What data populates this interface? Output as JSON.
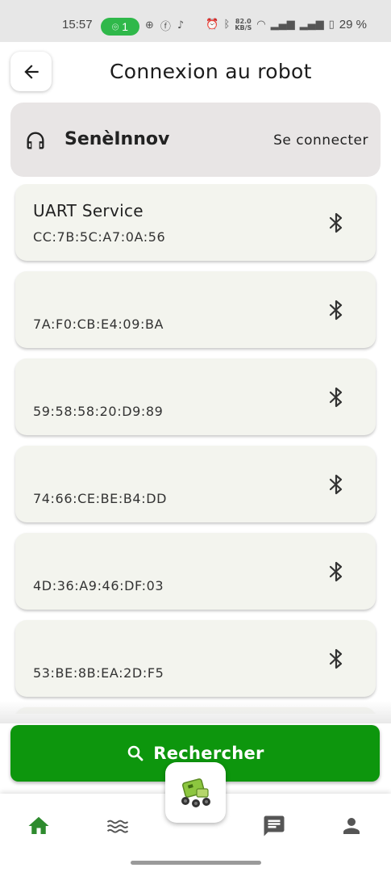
{
  "status_bar": {
    "time": "15:57",
    "hotspot_count": "1",
    "network_speed_top": "82.0",
    "network_speed_unit": "KB/S",
    "battery": "29 %"
  },
  "header": {
    "title": "Connexion au robot",
    "back_icon": "arrow-left-icon"
  },
  "connected_device": {
    "icon": "headphones-icon",
    "name": "SenèInnov",
    "action_label": "Se connecter"
  },
  "devices": [
    {
      "name": "UART Service",
      "mac": "CC:7B:5C:A7:0A:56"
    },
    {
      "name": "",
      "mac": "7A:F0:CB:E4:09:BA"
    },
    {
      "name": "",
      "mac": "59:58:58:20:D9:89"
    },
    {
      "name": "",
      "mac": "74:66:CE:BE:B4:DD"
    },
    {
      "name": "",
      "mac": "4D:36:A9:46:DF:03"
    },
    {
      "name": "",
      "mac": "53:BE:8B:EA:2D:F5"
    }
  ],
  "search_button": {
    "label": "Rechercher",
    "icon": "search-icon"
  },
  "bottom_nav": {
    "items": [
      "home-icon",
      "waves-icon",
      "robot-icon",
      "chat-icon",
      "person-icon"
    ],
    "active": "home-icon"
  },
  "colors": {
    "primary_green": "#0d960d",
    "active_nav": "#2e8b2e",
    "card_bg": "#f3f4ee",
    "connected_card_bg": "#e8e5e5"
  }
}
